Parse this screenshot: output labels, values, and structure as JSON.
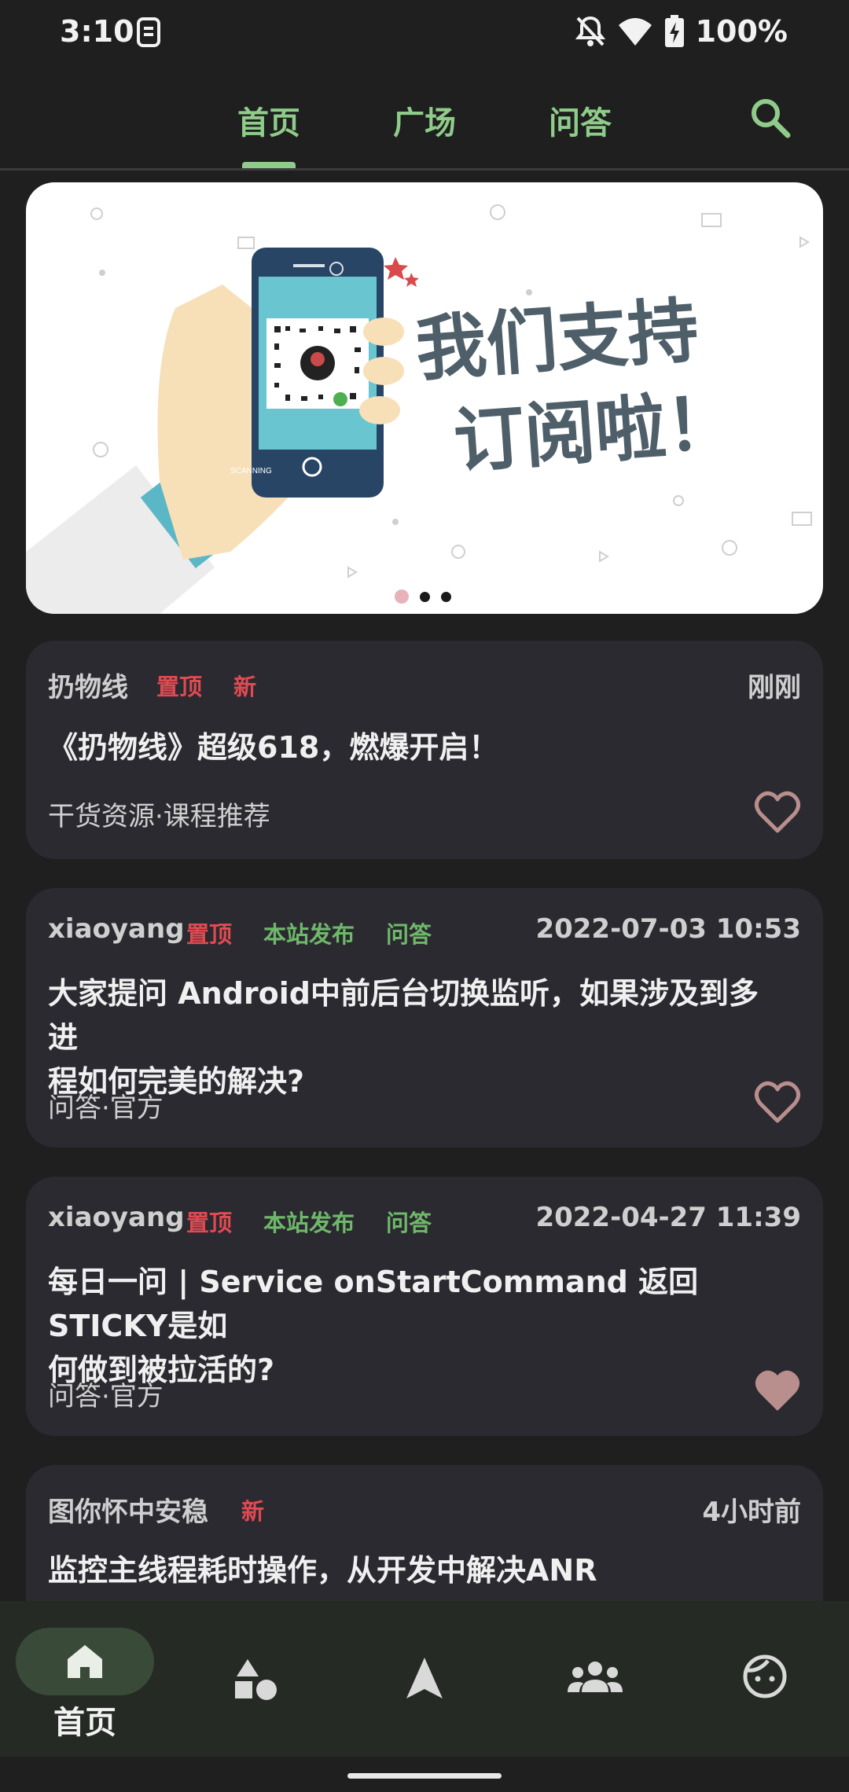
{
  "status_bar": {
    "time": "3:10",
    "battery": "100%"
  },
  "top_tabs": {
    "items": [
      {
        "label": "首页"
      },
      {
        "label": "广场"
      },
      {
        "label": "问答"
      }
    ],
    "active_index": 0,
    "accent_color": "#8fcc8a"
  },
  "banner": {
    "headline_line1": "我们支持",
    "headline_line2": "订阅啦！",
    "phone_caption": "SCANNING",
    "dots_count": 3,
    "active_dot": 0
  },
  "articles": [
    {
      "author": "扔物线",
      "tags_red": [
        "置顶",
        "新"
      ],
      "tags_green": [],
      "time": "刚刚",
      "title_line1": "《扔物线》超级618，燃爆开启！",
      "title_line2": "",
      "category": "干货资源·课程推荐",
      "liked": false
    },
    {
      "author": "xiaoyang",
      "tags_red": [
        "置顶"
      ],
      "tags_green": [
        "本站发布",
        "问答"
      ],
      "time": "2022-07-03 10:53",
      "title_line1": "大家提问 Android中前后台切换监听，如果涉及到多进",
      "title_line2": "程如何完美的解决?",
      "category": "问答·官方",
      "liked": false
    },
    {
      "author": "xiaoyang",
      "tags_red": [
        "置顶"
      ],
      "tags_green": [
        "本站发布",
        "问答"
      ],
      "time": "2022-04-27 11:39",
      "title_line1": "每日一问 | Service onStartCommand 返回STICKY是如",
      "title_line2": "何做到被拉活的?",
      "category": "问答·官方",
      "liked": true
    },
    {
      "author": "图你怀中安稳",
      "tags_red": [
        "新"
      ],
      "tags_green": [],
      "time": "4小时前",
      "title_line1": "监控主线程耗时操作，从开发中解决ANR",
      "title_line2": "",
      "category": "",
      "liked": false
    }
  ],
  "bottom_nav": {
    "items": [
      {
        "label": "首页",
        "icon": "home-icon"
      },
      {
        "label": "",
        "icon": "shapes-icon"
      },
      {
        "label": "",
        "icon": "navigation-arrow-icon"
      },
      {
        "label": "",
        "icon": "group-icon"
      },
      {
        "label": "",
        "icon": "face-icon"
      }
    ],
    "active_index": 0
  },
  "colors": {
    "background": "#1e1f1e",
    "card": "#2b2a30",
    "tag_red": "#e04a52",
    "tag_green": "#6fb86b",
    "heart": "#b98f8d"
  }
}
